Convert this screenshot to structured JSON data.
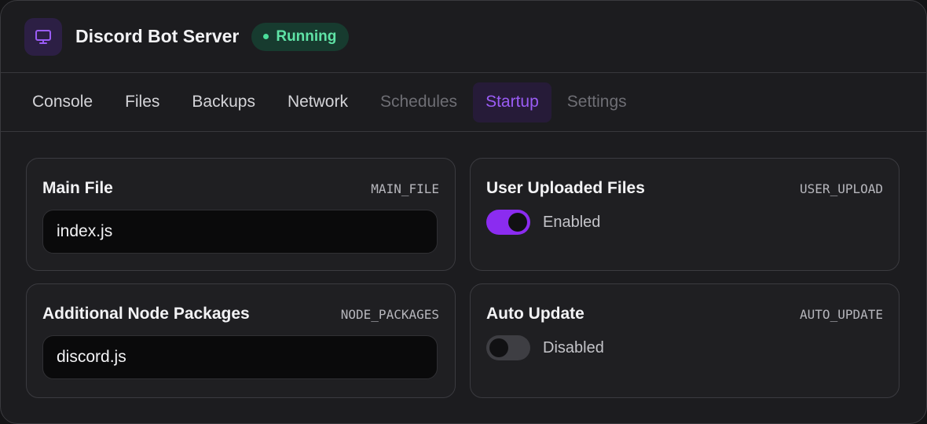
{
  "header": {
    "title": "Discord Bot Server",
    "status": "Running",
    "icon": "monitor-icon",
    "accent": "#8b2cf0",
    "status_color": "#5fe3a6"
  },
  "tabs": [
    {
      "label": "Console"
    },
    {
      "label": "Files"
    },
    {
      "label": "Backups"
    },
    {
      "label": "Network"
    },
    {
      "label": "Schedules"
    },
    {
      "label": "Startup"
    },
    {
      "label": "Settings"
    }
  ],
  "active_tab": "Startup",
  "variables": {
    "main_file": {
      "title": "Main File",
      "var": "MAIN_FILE",
      "value": "index.js"
    },
    "node_packages": {
      "title": "Additional Node Packages",
      "var": "NODE_PACKAGES",
      "value": "discord.js"
    },
    "user_upload": {
      "title": "User Uploaded Files",
      "var": "USER_UPLOAD",
      "state_label": "Enabled",
      "enabled": true
    },
    "auto_update": {
      "title": "Auto Update",
      "var": "AUTO_UPDATE",
      "state_label": "Disabled",
      "enabled": false
    }
  }
}
